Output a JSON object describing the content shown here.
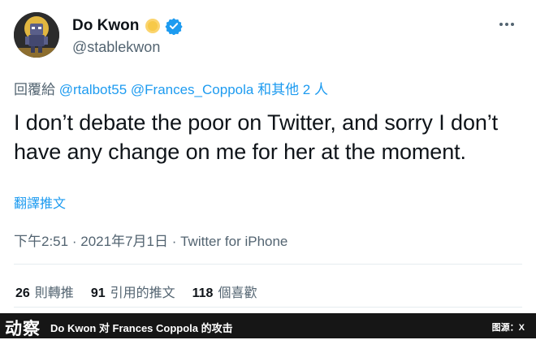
{
  "author": {
    "name": "Do Kwon",
    "handle": "@stablekwon"
  },
  "reply": {
    "prefix": "回覆給",
    "mention1": "@rtalbot55",
    "mention2": "@Frances_Coppola",
    "others": "和其他 2 人"
  },
  "tweet": {
    "text": "I don’t debate the poor on Twitter, and sorry I don’t have any change on me for her at the moment.",
    "translate_label": "翻譯推文"
  },
  "meta": {
    "time": "下午2:51",
    "date": "2021年7月1日",
    "source": "Twitter for iPhone",
    "separator": "·"
  },
  "stats": {
    "retweets_count": "26",
    "retweets_label": "則轉推",
    "quotes_count": "91",
    "quotes_label": "引用的推文",
    "likes_count": "118",
    "likes_label": "個喜歡"
  },
  "banner": {
    "logo": "动察",
    "title": "Do Kwon 对 Frances Coppola 的攻击",
    "credit": "图源：X"
  },
  "colors": {
    "link": "#1d9bf0",
    "secondary_text": "#536471",
    "banner_bg": "#161616"
  },
  "icons": [
    "avatar-character",
    "sun-emoji-icon",
    "verified-badge-icon",
    "more-options-icon"
  ]
}
